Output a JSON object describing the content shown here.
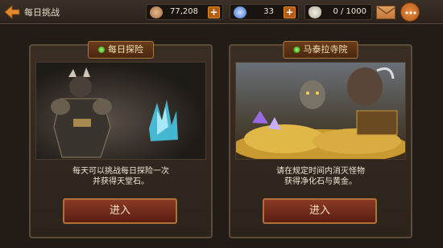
{
  "header": {
    "title": "每日挑战",
    "wood": "77,208",
    "gems": "33",
    "stamina": "0 / 1000"
  },
  "panels": [
    {
      "title": "每日探险",
      "desc_line1": "每天可以挑战每日探险一次",
      "desc_line2": "并获得天堂石。",
      "button": "进入"
    },
    {
      "title": "马泰拉寺院",
      "desc_line1": "请在规定时间内消灭怪物",
      "desc_line2": "获得净化石与黄金。",
      "button": "进入"
    }
  ],
  "colors": {
    "accent_orange": "#b55a12",
    "button_red": "#7a3020",
    "gem_green": "#4aca2a"
  },
  "icons": [
    "back-arrow-icon",
    "wood-icon",
    "blue-gem-icon",
    "stamina-flask-icon",
    "mail-icon",
    "chat-icon"
  ]
}
